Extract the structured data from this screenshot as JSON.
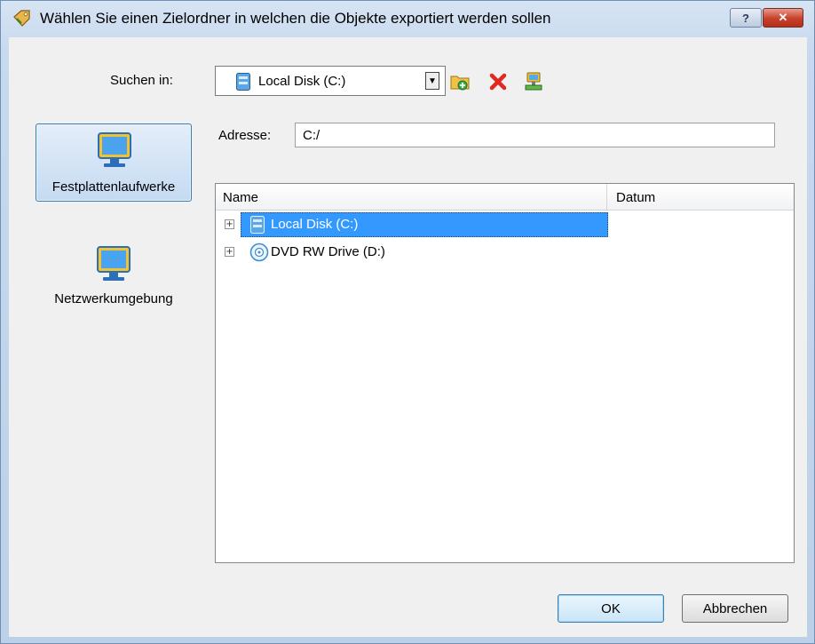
{
  "window": {
    "title": "Wählen Sie einen Zielordner in welchen die Objekte exportiert werden sollen",
    "help_label": "?",
    "close_label": "✕"
  },
  "toolbar": {
    "lookin_label": "Suchen in:",
    "lookin_value": "Local Disk (C:)",
    "dropdown_glyph": "▼",
    "tools": [
      "new-folder-icon",
      "delete-icon",
      "network-drive-icon"
    ]
  },
  "address": {
    "label": "Adresse:",
    "value": "C:/"
  },
  "places": [
    {
      "label": "Festplattenlaufwerke",
      "icon": "computer-monitor-icon",
      "active": true
    },
    {
      "label": "Netzwerkumgebung",
      "icon": "network-computer-icon",
      "active": false
    }
  ],
  "list": {
    "columns": [
      "Name",
      "Datum"
    ],
    "rows": [
      {
        "name": "Local Disk (C:)",
        "icon": "hard-disk-icon",
        "selected": true,
        "expander": "+"
      },
      {
        "name": "DVD RW Drive (D:)",
        "icon": "dvd-drive-icon",
        "selected": false,
        "expander": "+"
      }
    ]
  },
  "buttons": {
    "ok": "OK",
    "cancel": "Abbrechen"
  },
  "colors": {
    "selection": "#3399ff",
    "title_bar": "#c7d9ee",
    "close_button": "#c6402a"
  }
}
